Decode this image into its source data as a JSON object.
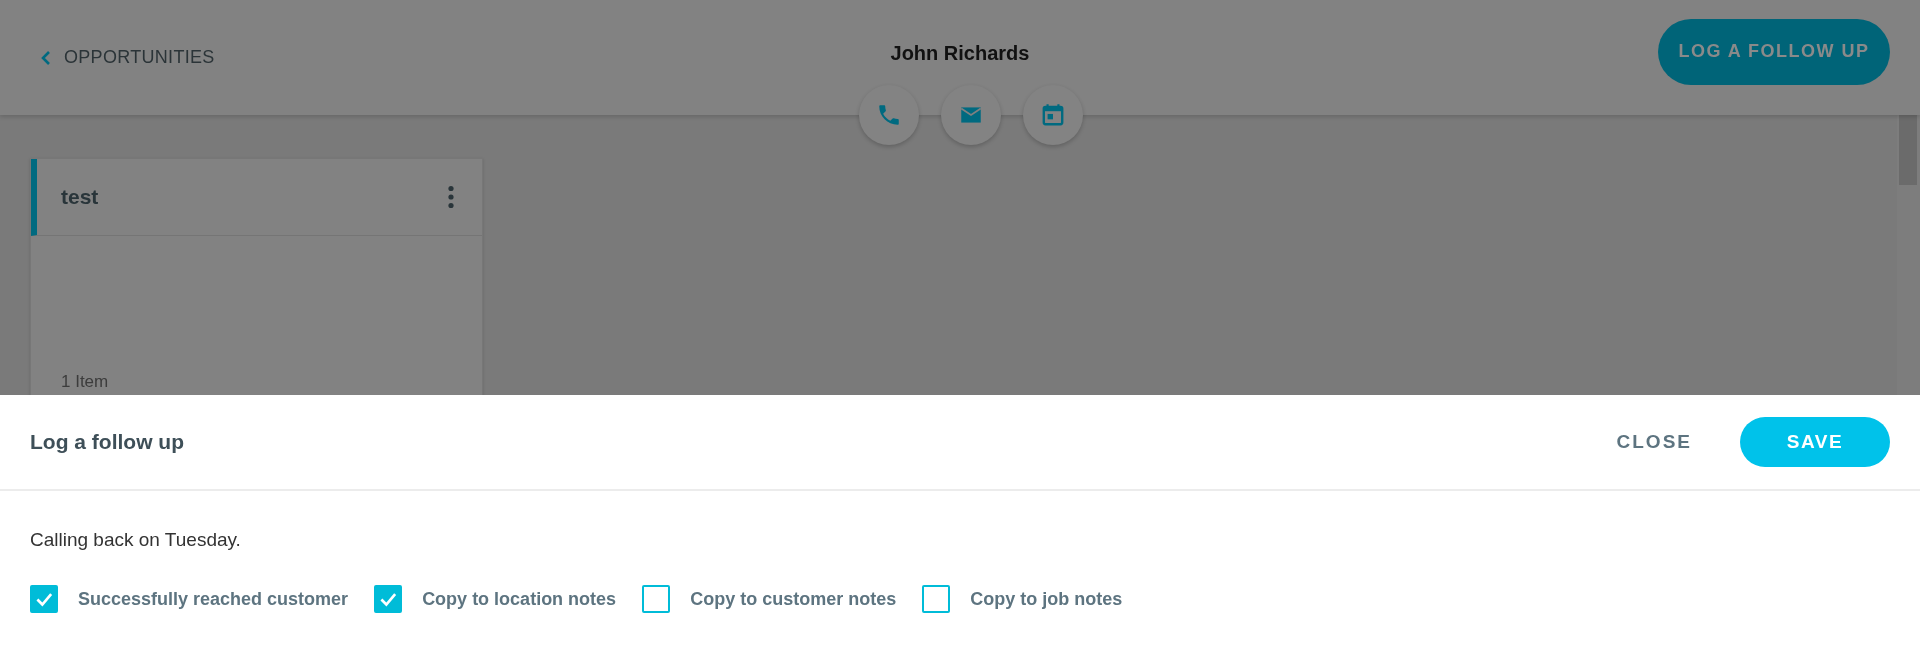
{
  "header": {
    "back_link": "OPPORTUNITIES",
    "title": "John Richards",
    "action_button": "LOG A FOLLOW UP"
  },
  "card": {
    "title": "test",
    "count": "1 Item"
  },
  "panel": {
    "title": "Log a follow up",
    "close_button": "CLOSE",
    "save_button": "SAVE",
    "note": "Calling back on Tuesday.",
    "options": [
      {
        "label": "Successfully reached customer",
        "checked": true
      },
      {
        "label": "Copy to location notes",
        "checked": true
      },
      {
        "label": "Copy to customer notes",
        "checked": false
      },
      {
        "label": "Copy to job notes",
        "checked": false
      }
    ]
  }
}
